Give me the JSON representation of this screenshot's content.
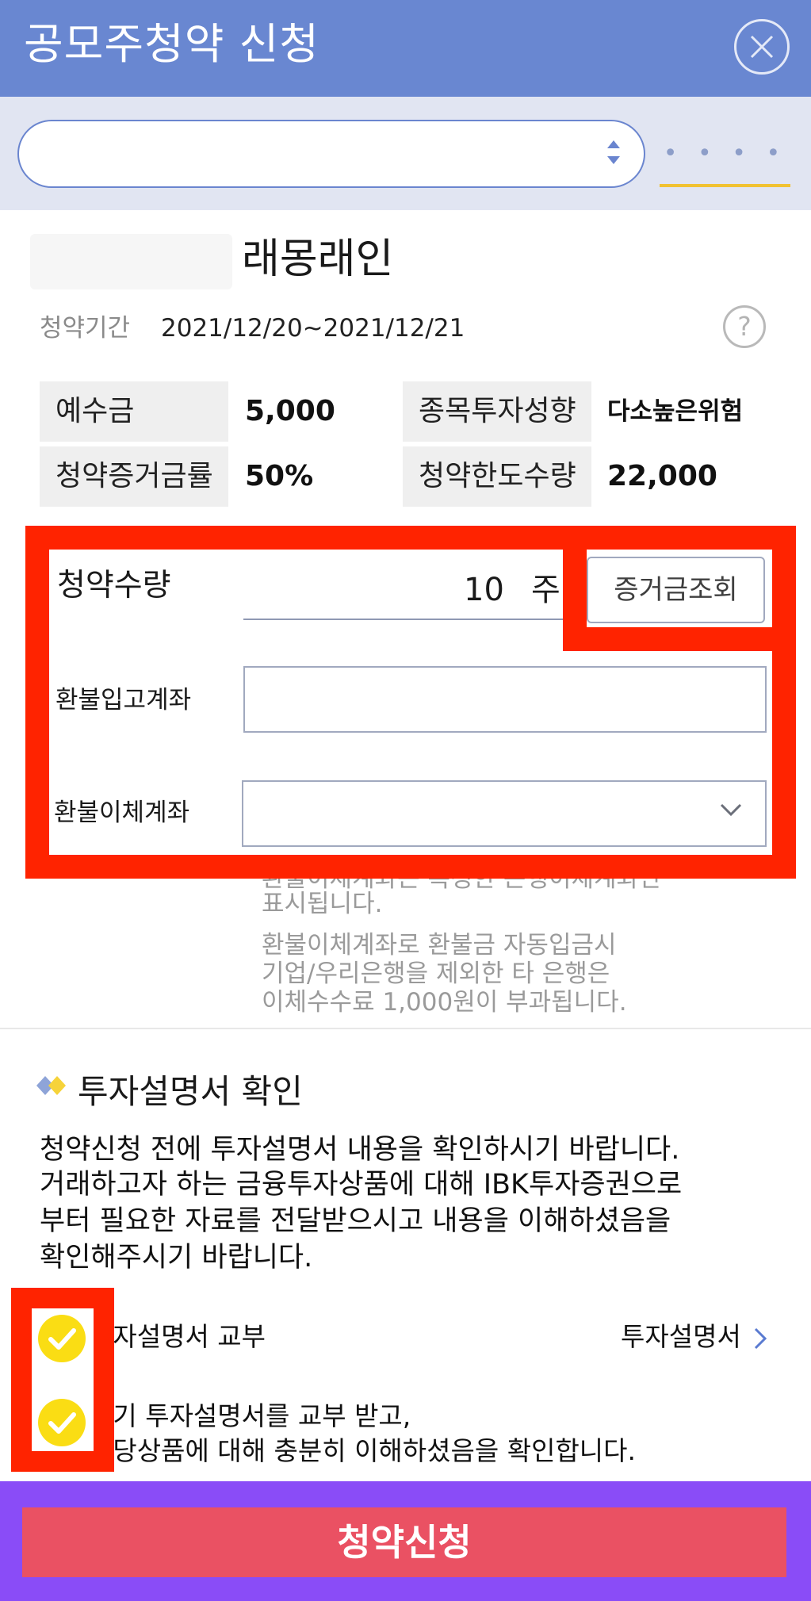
{
  "header": {
    "title": "공모주청약 신청",
    "close_icon": "close-circle-icon"
  },
  "account_bar": {
    "account_select_value": "",
    "tab_label": "• • • •",
    "tab_underline_color": "#f1c232"
  },
  "stock": {
    "name": "래몽래인",
    "period_label": "청약기간",
    "period_value": "2021/12/20~2021/12/21",
    "help_icon": "question-circle-icon"
  },
  "info_grid": [
    {
      "label": "예수금",
      "value": "5,000"
    },
    {
      "label": "종목투자성향",
      "value": "다소높은위험"
    },
    {
      "label": "청약증거금률",
      "value": "50%"
    },
    {
      "label": "청약한도수량",
      "value": "22,000"
    }
  ],
  "form": {
    "quantity_label": "청약수량",
    "quantity_value": "10",
    "quantity_unit": "주",
    "margin_button": "증거금조회",
    "refund_in_label": "환불입고계좌",
    "refund_in_value": "",
    "refund_transfer_label": "환불이체계좌",
    "refund_transfer_value": ""
  },
  "notes": [
    "환불이체계좌는 특정한 은행이체계좌만",
    "표시됩니다.",
    "환불이체계좌로 환불금 자동입금시",
    "기업/우리은행을 제외한 타 은행은",
    "이체수수료 1,000원이 부과됩니다."
  ],
  "prospectus": {
    "title": "투자설명서 확인",
    "body": [
      "청약신청 전에 투자설명서 내용을 확인하시기 바랍니다.",
      "거래하고자 하는 금융투자상품에 대해 IBK투자증권으로",
      "부터 필요한 자료를 전달받으시고 내용을 이해하셨음을",
      "확인해주시기 바랍니다."
    ],
    "check1_label": "투자설명서 교부",
    "link_label": "투자설명서",
    "check2_line1": "상기 투자설명서를 교부 받고,",
    "check2_line2": "해당상품에 대해 충분히 이해하셨음을 확인합니다."
  },
  "submit": {
    "label": "청약신청"
  },
  "colors": {
    "header": "#6987d1",
    "submit": "#ea5163",
    "bottom_bar": "#8a4cf7",
    "highlight": "#ff2300",
    "check": "#fadd14"
  }
}
